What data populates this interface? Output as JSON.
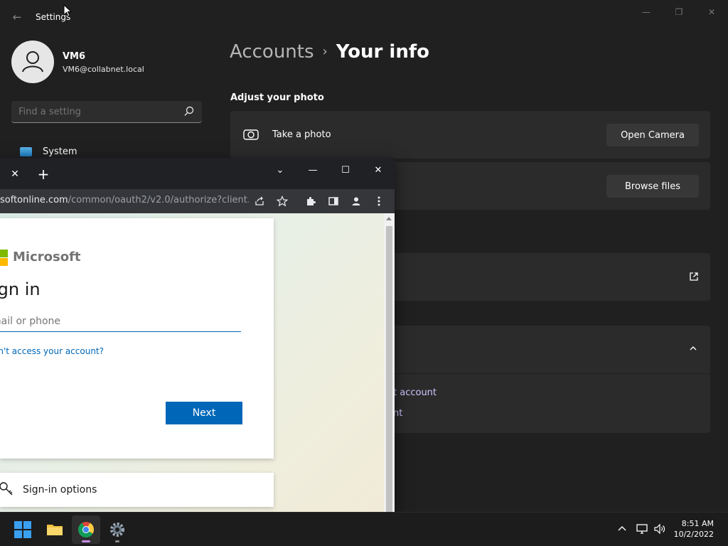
{
  "settings": {
    "title": "Settings",
    "user": {
      "name": "VM6",
      "email": "VM6@collabnet.local"
    },
    "search_placeholder": "Find a setting",
    "nav": [
      {
        "label": "System",
        "icon": "monitor-icon"
      }
    ],
    "breadcrumb": {
      "parent": "Accounts",
      "separator": "›",
      "current": "Your info"
    },
    "section_title": "Adjust your photo",
    "take_photo": {
      "label": "Take a photo",
      "button": "Open Camera"
    },
    "choose_file": {
      "button": "Browse files"
    },
    "partial_text_1": "t account",
    "partial_text_2": "nt"
  },
  "chrome": {
    "url_host": "softonline.com",
    "url_path": "/common/oauth2/v2.0/authorize?client...",
    "signin": {
      "brand": "Microsoft",
      "title": "ign in",
      "email_placeholder": "mail or phone",
      "cant_access": "an't access your account?",
      "next_button": "Next",
      "options_label": "Sign-in options"
    }
  },
  "taskbar": {
    "time": "8:51 AM",
    "date": "10/2/2022"
  },
  "colors": {
    "accent_blue": "#0067b8",
    "settings_bg": "#202020",
    "card_bg": "#2b2b2b"
  }
}
